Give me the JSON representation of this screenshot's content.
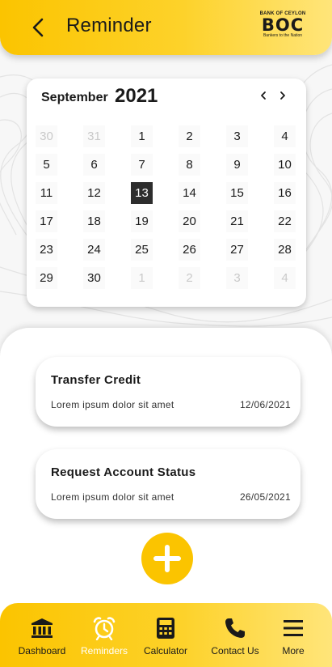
{
  "header": {
    "title": "Reminder",
    "back_icon": "chevron-left-icon",
    "logo": {
      "line1": "BANK OF CEYLON",
      "line2": "BOC",
      "line3": "Bankers to the Nation"
    }
  },
  "calendar": {
    "month": "September",
    "year": "2021",
    "selected_day": "13",
    "weeks": [
      [
        {
          "d": "30",
          "m": true
        },
        {
          "d": "31",
          "m": true
        },
        {
          "d": "1"
        },
        {
          "d": "2"
        },
        {
          "d": "3"
        },
        {
          "d": "4"
        }
      ],
      [
        {
          "d": "5"
        },
        {
          "d": "6"
        },
        {
          "d": "7"
        },
        {
          "d": "8"
        },
        {
          "d": "9"
        },
        {
          "d": "10"
        }
      ],
      [
        {
          "d": "11"
        },
        {
          "d": "12"
        },
        {
          "d": "13",
          "s": true
        },
        {
          "d": "14"
        },
        {
          "d": "15"
        },
        {
          "d": "16"
        }
      ],
      [
        {
          "d": "17"
        },
        {
          "d": "18"
        },
        {
          "d": "19"
        },
        {
          "d": "20"
        },
        {
          "d": "21"
        },
        {
          "d": "22"
        }
      ],
      [
        {
          "d": "23"
        },
        {
          "d": "24"
        },
        {
          "d": "25"
        },
        {
          "d": "26"
        },
        {
          "d": "27"
        },
        {
          "d": "28"
        }
      ],
      [
        {
          "d": "29"
        },
        {
          "d": "30"
        },
        {
          "d": "1",
          "m": true
        },
        {
          "d": "2",
          "m": true
        },
        {
          "d": "3",
          "m": true
        },
        {
          "d": "4",
          "m": true
        }
      ]
    ]
  },
  "reminders": [
    {
      "title": "Transfer Credit",
      "description": "Lorem ipsum dolor sit amet",
      "date": "12/06/2021"
    },
    {
      "title": "Request Account Status",
      "description": "Lorem ipsum dolor sit amet",
      "date": "26/05/2021"
    }
  ],
  "add_button_icon": "plus-icon",
  "nav": [
    {
      "label": "Dashboard",
      "icon": "bank-icon",
      "active": false
    },
    {
      "label": "Reminders",
      "icon": "alarm-clock-icon",
      "active": true
    },
    {
      "label": "Calculator",
      "icon": "calculator-icon",
      "active": false
    },
    {
      "label": "Contact Us",
      "icon": "phone-icon",
      "active": false
    },
    {
      "label": "More",
      "icon": "menu-icon",
      "active": false
    }
  ],
  "colors": {
    "accent": "#fbc400",
    "accent_light": "#ffe57a",
    "selected_day_bg": "#2d2d2d",
    "muted_text": "#c9c9c9"
  }
}
